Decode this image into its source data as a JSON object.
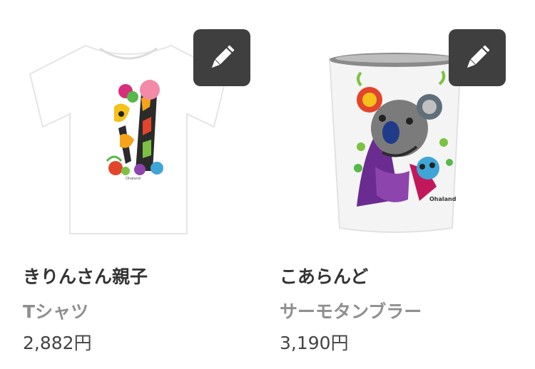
{
  "products": [
    {
      "title": "きりんさん親子",
      "type": "Tシャツ",
      "price": "2,882円",
      "image_icon": "giraffe-tshirt-image",
      "edit_icon": "pencil-icon"
    },
    {
      "title": "こあらんど",
      "type": "サーモタンブラー",
      "price": "3,190円",
      "image_icon": "koala-tumbler-image",
      "edit_icon": "pencil-icon",
      "print_text": "Ohaland"
    }
  ],
  "colors": {
    "edit_button_bg": "#3f3f3f",
    "title": "#333333",
    "type": "#8f8f8f",
    "price": "#444444"
  }
}
